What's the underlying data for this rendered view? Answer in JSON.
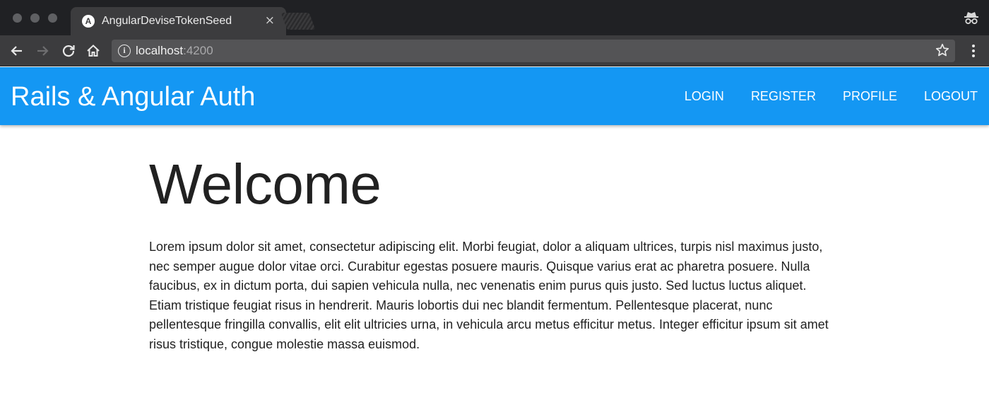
{
  "browser": {
    "tab": {
      "favicon": "angular-logo",
      "favicon_letter": "A",
      "title": "AngularDeviseTokenSeed",
      "close_glyph": "×"
    },
    "address": {
      "host": "localhost",
      "port": ":4200"
    },
    "icons": {
      "back": "back-arrow-icon",
      "forward": "forward-arrow-icon",
      "reload": "reload-icon",
      "home": "home-icon",
      "info": "info-icon",
      "bookmark": "star-icon",
      "menu": "menu-icon",
      "incognito": "incognito-icon"
    }
  },
  "theme": {
    "primary": "#1497f3",
    "chrome_dark": "#202124",
    "chrome_toolbar": "#3c3c3e"
  },
  "navbar": {
    "brand": "Rails & Angular Auth",
    "links": [
      {
        "label": "LOGIN"
      },
      {
        "label": "REGISTER"
      },
      {
        "label": "PROFILE"
      },
      {
        "label": "LOGOUT"
      }
    ]
  },
  "main": {
    "heading": "Welcome",
    "body": "Lorem ipsum dolor sit amet, consectetur adipiscing elit. Morbi feugiat, dolor a aliquam ultrices, turpis nisl maximus justo, nec semper augue dolor vitae orci. Curabitur egestas posuere mauris. Quisque varius erat ac pharetra posuere. Nulla faucibus, ex in dictum porta, dui sapien vehicula nulla, nec venenatis enim purus quis justo. Sed luctus luctus aliquet. Etiam tristique feugiat risus in hendrerit. Mauris lobortis dui nec blandit fermentum. Pellentesque placerat, nunc pellentesque fringilla convallis, elit elit ultricies urna, in vehicula arcu metus efficitur metus. Integer efficitur ipsum sit amet risus tristique, congue molestie massa euismod."
  }
}
